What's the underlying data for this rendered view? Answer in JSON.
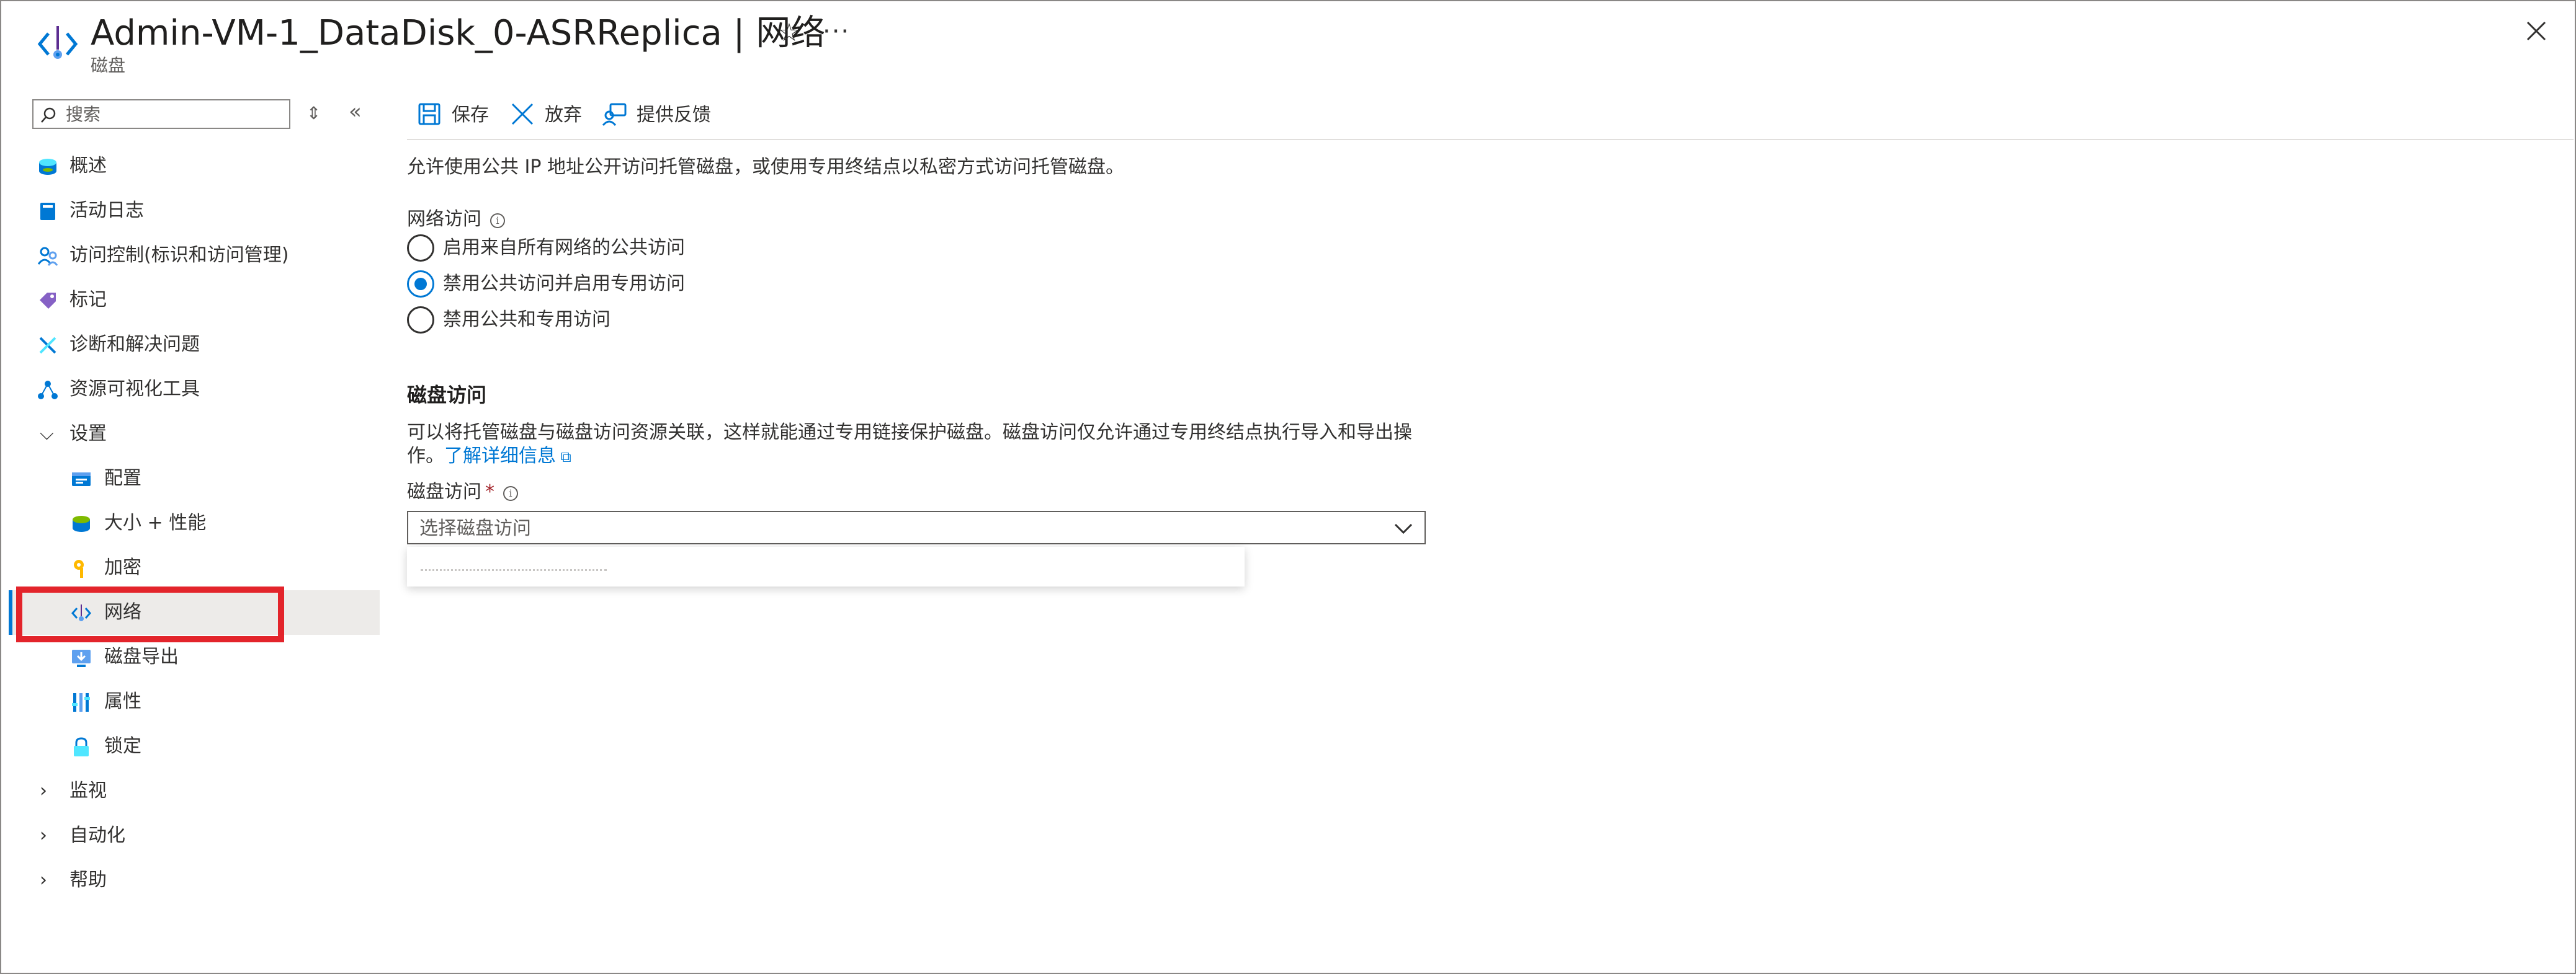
{
  "header": {
    "title": "Admin-VM-1_DataDisk_0-ASRReplica | 网络",
    "subtitle": "磁盘",
    "more": "···"
  },
  "sidebar": {
    "search_placeholder": "搜索",
    "items": [
      {
        "label": "概述",
        "icon": "disk-overview-icon"
      },
      {
        "label": "活动日志",
        "icon": "activity-log-icon"
      },
      {
        "label": "访问控制(标识和访问管理)",
        "icon": "access-control-icon"
      },
      {
        "label": "标记",
        "icon": "tag-icon"
      },
      {
        "label": "诊断和解决问题",
        "icon": "diagnose-icon"
      },
      {
        "label": "资源可视化工具",
        "icon": "resource-visualizer-icon"
      },
      {
        "label": "设置",
        "icon": "chevron-down-icon"
      },
      {
        "label": "配置",
        "icon": "configuration-icon"
      },
      {
        "label": "大小 + 性能",
        "icon": "size-performance-icon"
      },
      {
        "label": "加密",
        "icon": "encryption-icon"
      },
      {
        "label": "网络",
        "icon": "network-icon"
      },
      {
        "label": "磁盘导出",
        "icon": "disk-export-icon"
      },
      {
        "label": "属性",
        "icon": "properties-icon"
      },
      {
        "label": "锁定",
        "icon": "lock-icon"
      },
      {
        "label": "监视",
        "icon": "chevron-right-icon"
      },
      {
        "label": "自动化",
        "icon": "chevron-right-icon"
      },
      {
        "label": "帮助",
        "icon": "chevron-right-icon"
      }
    ]
  },
  "toolbar": {
    "save": "保存",
    "discard": "放弃",
    "feedback": "提供反馈"
  },
  "main": {
    "description": "允许使用公共 IP 地址公开访问托管磁盘，或使用专用终结点以私密方式访问托管磁盘。",
    "network_access_label": "网络访问",
    "radio_options": [
      {
        "label": "启用来自所有网络的公共访问",
        "selected": false
      },
      {
        "label": "禁用公共访问并启用专用访问",
        "selected": true
      },
      {
        "label": "禁用公共和专用访问",
        "selected": false
      }
    ],
    "disk_access_heading": "磁盘访问",
    "disk_access_desc_line1": "可以将托管磁盘与磁盘访问资源关联，这样就能通过专用链接保护磁盘。磁盘访问仅允许通过专用终结点执行导入和导出操",
    "disk_access_desc_line2": "作。",
    "learn_more": "了解详细信息",
    "disk_access_field_label": "磁盘访问",
    "required_mark": "*",
    "dropdown_placeholder": "选择磁盘访问"
  },
  "colors": {
    "accent": "#0078d4",
    "highlight_box": "#e3242b",
    "selected_bg": "#edebe9"
  }
}
